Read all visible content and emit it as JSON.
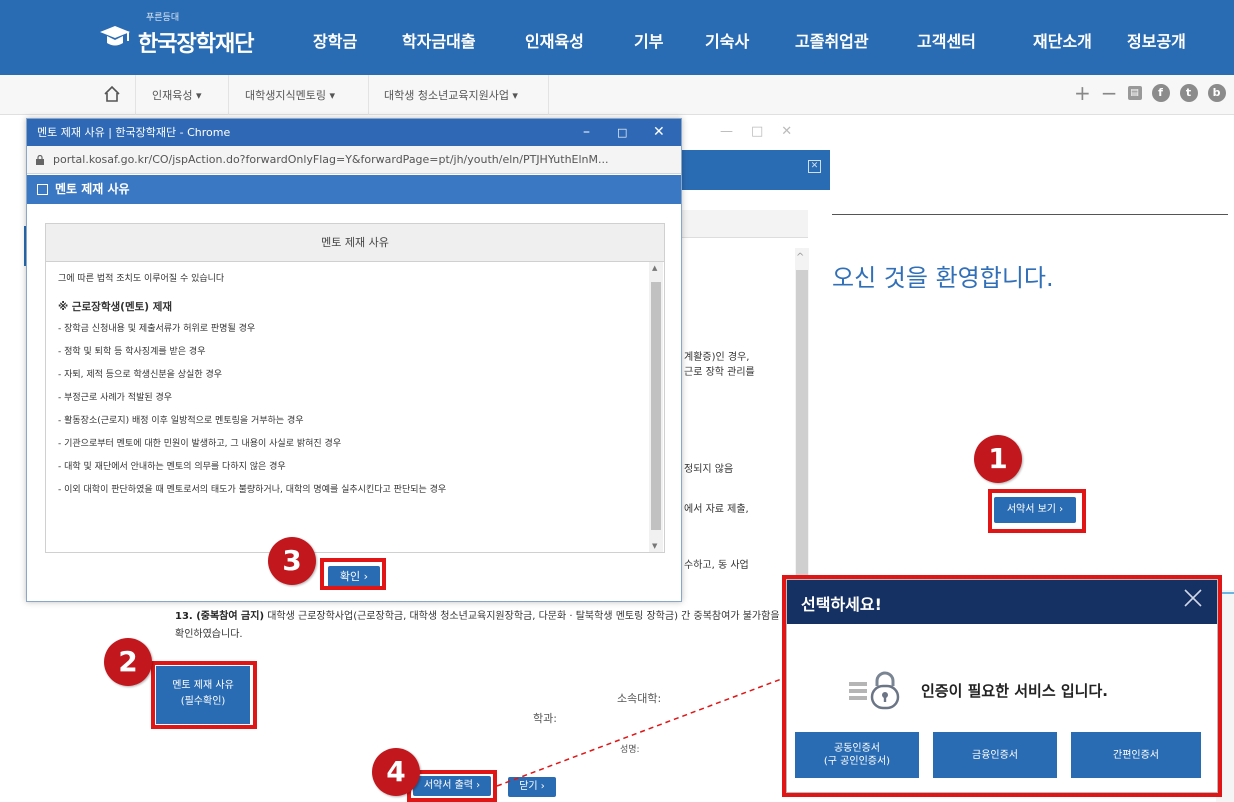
{
  "topnav": {
    "logo_small": "푸른등대",
    "logo_text": "한국장학재단",
    "menu": [
      "장학금",
      "학자금대출",
      "인재육성",
      "기부",
      "기숙사",
      "고졸취업관",
      "고객센터",
      "재단소개",
      "정보공개"
    ]
  },
  "subnav": {
    "crumbs": [
      "인재육성 ▾",
      "대학생지식멘토링 ▾",
      "대학생 청소년교육지원사업 ▾"
    ]
  },
  "page": {
    "welcome_text": "오신 것을 환영합니다.",
    "fragments": [
      "계활증)인 경우,",
      "근로 장학 관리를",
      "정되지 않음",
      "에서 자료 제출,",
      "수하고, 동 사업"
    ],
    "item13_bold": "13. (중복참여 금지)",
    "item13_text": " 대학생 근로장학사업(근로장학금, 대학생 청소년교육지원장학금, 다문화 · 탈북학생 멘토링 장학금) 간 중복참여가 불가함을 확인하였습니다.",
    "reason_button_line1": "멘토 제재 사유",
    "reason_button_line2": "(필수확인)",
    "label_univ": "소속대학:",
    "label_dept": "학과:",
    "label_name": "성명:",
    "view_pledge_button": "서약서 보기 ›",
    "print_pledge_button": "서약서 출력 ›",
    "close_button": "닫기 ›"
  },
  "popup": {
    "window_title": "멘토 제재 사유 | 한국장학재단 - Chrome",
    "url": "portal.kosaf.go.kr/CO/jspAction.do?forwardOnlyFlag=Y&forwardPage=pt/jh/youth/eln/PTJHYuthElnM...",
    "header": "멘토 제재 사유",
    "body_title": "멘토 제재 사유",
    "lines_top": [
      "그에 따른 법적 조치도 이루어질 수 있습니다"
    ],
    "section_heading": "※ 근로장학생(멘토) 제재",
    "rules": [
      "- 장학금 신청내용 및 제출서류가 허위로 판명될 경우",
      "- 정학 및 퇴학 등 학사징계를 받은 경우",
      "- 자퇴, 제적 등으로 학생신분을 상실한 경우",
      "- 부정근로 사례가 적발된 경우",
      "- 활동장소(근로지) 배정 이후 일방적으로 멘토링을 거부하는 경우",
      "- 기관으로부터 멘토에 대한 민원이 발생하고, 그 내용이 사실로 밝혀진 경우",
      "- 대학 및 재단에서 안내하는 멘토의 의무를 다하지 않은 경우",
      "- 이외 대학이 판단하였을 때 멘토로서의 태도가 불량하거나, 대학의 명예를 실추시킨다고 판단되는 경우"
    ],
    "ok_button": "확인 ›"
  },
  "cert_dialog": {
    "title": "선택하세요!",
    "message": "인증이 필요한 서비스 입니다.",
    "buttons": [
      {
        "line1": "공동인증서",
        "line2": "(구 공인인증서)"
      },
      {
        "line1": "금융인증서",
        "line2": ""
      },
      {
        "line1": "간편인증서",
        "line2": ""
      }
    ]
  },
  "badges": [
    "1",
    "2",
    "3",
    "4"
  ],
  "icons": {
    "home": "home-icon",
    "lock": "lock-icon",
    "close": "close-icon",
    "padlock": "padlock-icon"
  },
  "colors": {
    "brand_blue": "#2a6cb3",
    "dialog_navy": "#153063",
    "highlight_red": "#e01515",
    "badge_red": "#c2171d"
  }
}
